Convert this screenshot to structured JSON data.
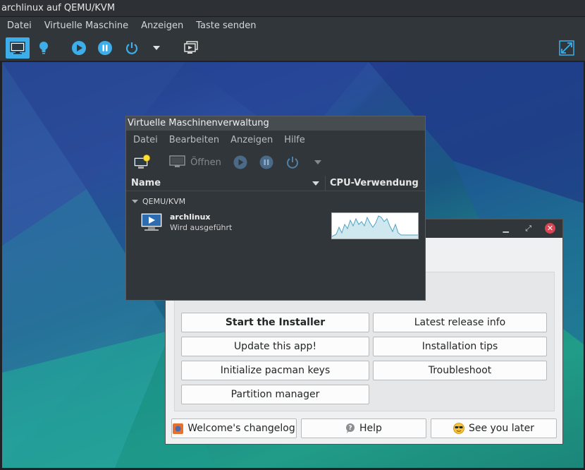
{
  "outer": {
    "title": "archlinux auf QEMU/KVM",
    "menu": [
      "Datei",
      "Virtuelle Maschine",
      "Anzeigen",
      "Taste senden"
    ]
  },
  "vmm": {
    "title": "Virtuelle Maschinenverwaltung",
    "menu": [
      "Datei",
      "Bearbeiten",
      "Anzeigen",
      "Hilfe"
    ],
    "open_label": "Öffnen",
    "col_name": "Name",
    "col_cpu": "CPU-Verwendung",
    "group": "QEMU/KVM",
    "vm_name": "archlinux",
    "vm_status": "Wird ausgeführt"
  },
  "welcome": {
    "buttons": {
      "start_installer": "Start the Installer",
      "latest_release": "Latest release info",
      "update_app": "Update this app!",
      "install_tips": "Installation tips",
      "init_pacman": "Initialize pacman keys",
      "troubleshoot": "Troubleshoot",
      "partition_manager": "Partition manager"
    },
    "footer": {
      "changelog": "Welcome's changelog",
      "help": "Help",
      "see_you_later": "See you later"
    }
  },
  "colors": {
    "accent": "#3daee9",
    "close": "#da4453",
    "cpu_fill": "#cfe7ee",
    "cpu_line": "#4fa3bf"
  }
}
